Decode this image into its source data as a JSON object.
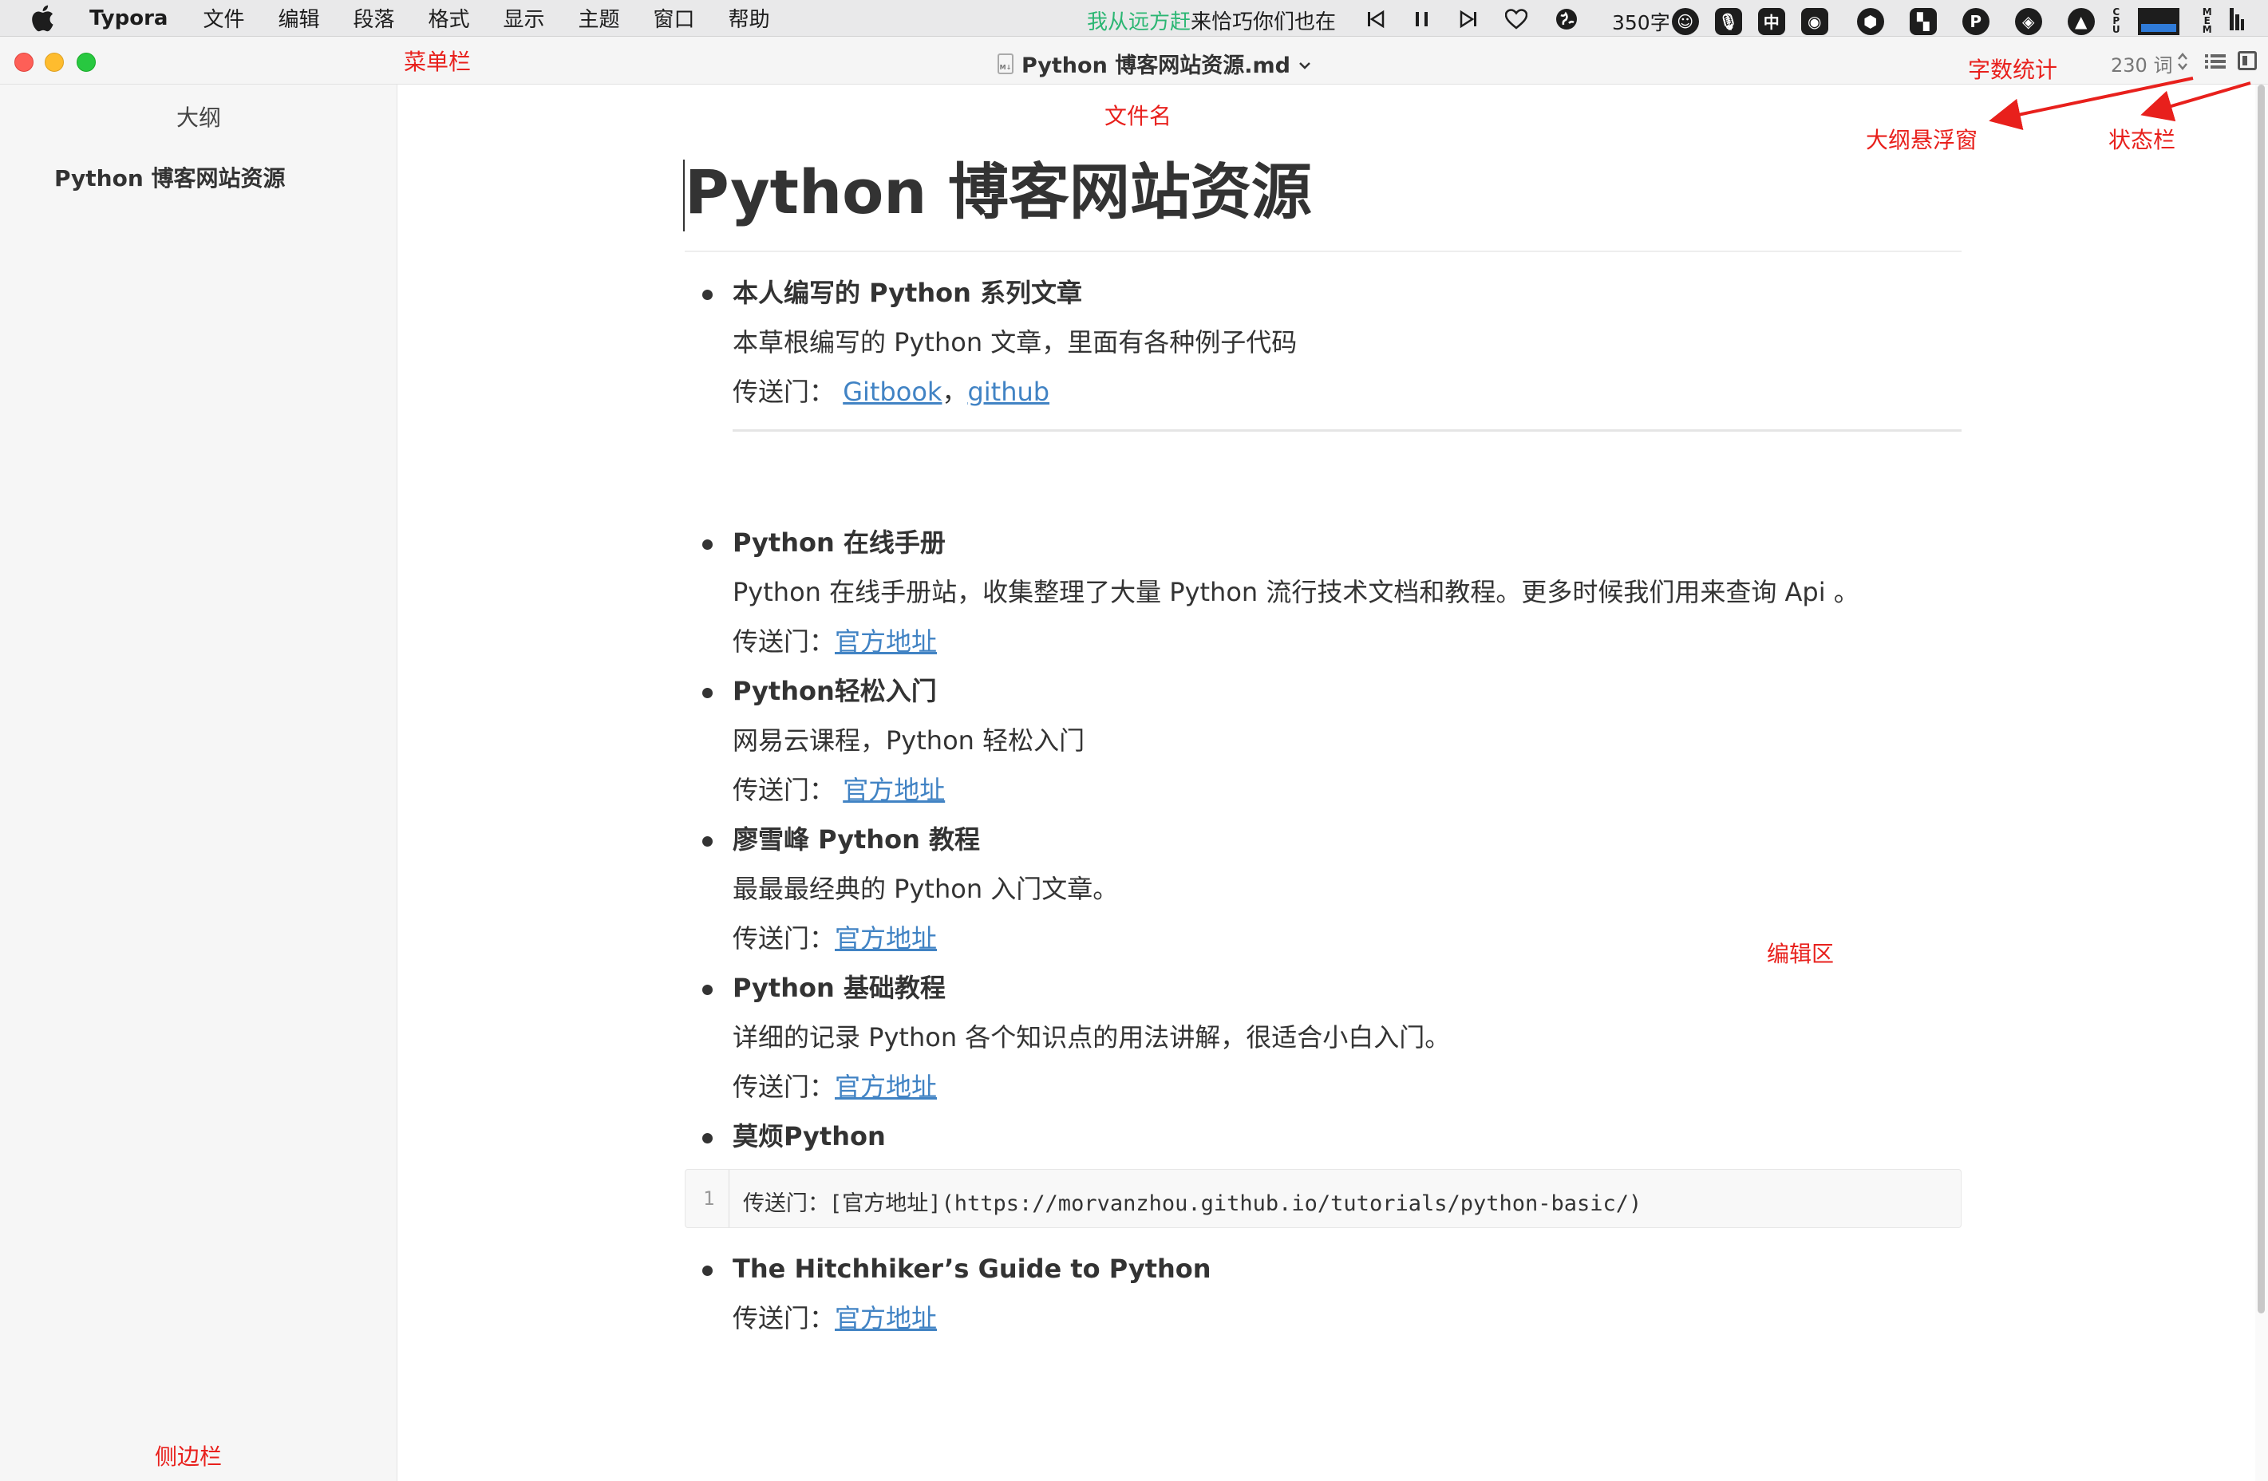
{
  "menubar": {
    "app_name": "Typora",
    "menus": [
      "文件",
      "编辑",
      "段落",
      "格式",
      "显示",
      "主题",
      "窗口",
      "帮助"
    ],
    "lyric_highlight": "我从远方赶",
    "lyric_rest": "来恰巧你们也在",
    "char_count": "350字",
    "ime": "中"
  },
  "window": {
    "filename": "Python 博客网站资源.md",
    "word_count": "230 词"
  },
  "sidebar": {
    "title": "大纲",
    "outline": [
      "Python 博客网站资源"
    ]
  },
  "document": {
    "title": "Python 博客网站资源",
    "items": [
      {
        "title": "本人编写的 Python 系列文章",
        "desc": "本草根编写的 Python 文章，里面有各种例子代码",
        "link_prefix": "传送门： ",
        "links": [
          "Gitbook",
          "github"
        ],
        "link_sep": "，"
      },
      {
        "title": "Python 在线手册",
        "desc": "Python 在线手册站，收集整理了大量 Python 流行技术文档和教程。更多时候我们用来查询 Api 。",
        "link_prefix": "传送门：",
        "link": "官方地址"
      },
      {
        "title": "Python轻松入门",
        "desc": "网易云课程，Python 轻松入门",
        "link_prefix": "传送门： ",
        "link": "官方地址"
      },
      {
        "title": "廖雪峰 Python 教程",
        "desc": "最最最经典的 Python 入门文章。",
        "link_prefix": "传送门：",
        "link": "官方地址"
      },
      {
        "title": "Python 基础教程",
        "desc": "详细的记录 Python 各个知识点的用法讲解，很适合小白入门。",
        "link_prefix": "传送门：",
        "link": "官方地址"
      },
      {
        "title": "莫烦Python",
        "code_line_number": "1",
        "code": "传送门：[官方地址](https://morvanzhou.github.io/tutorials/python-basic/)"
      },
      {
        "title": "The Hitchhiker’s Guide to Python",
        "link_prefix": "传送门：",
        "link": "官方地址"
      }
    ]
  },
  "annotations": {
    "menubar": "菜单栏",
    "filename": "文件名",
    "word_count": "字数统计",
    "outline_popup": "大纲悬浮窗",
    "status_bar": "状态栏",
    "editor": "编辑区",
    "sidebar": "侧边栏",
    "color": "#e8201c"
  },
  "colors": {
    "link": "#4183c4",
    "lyric_highlight": "#2bb673"
  }
}
